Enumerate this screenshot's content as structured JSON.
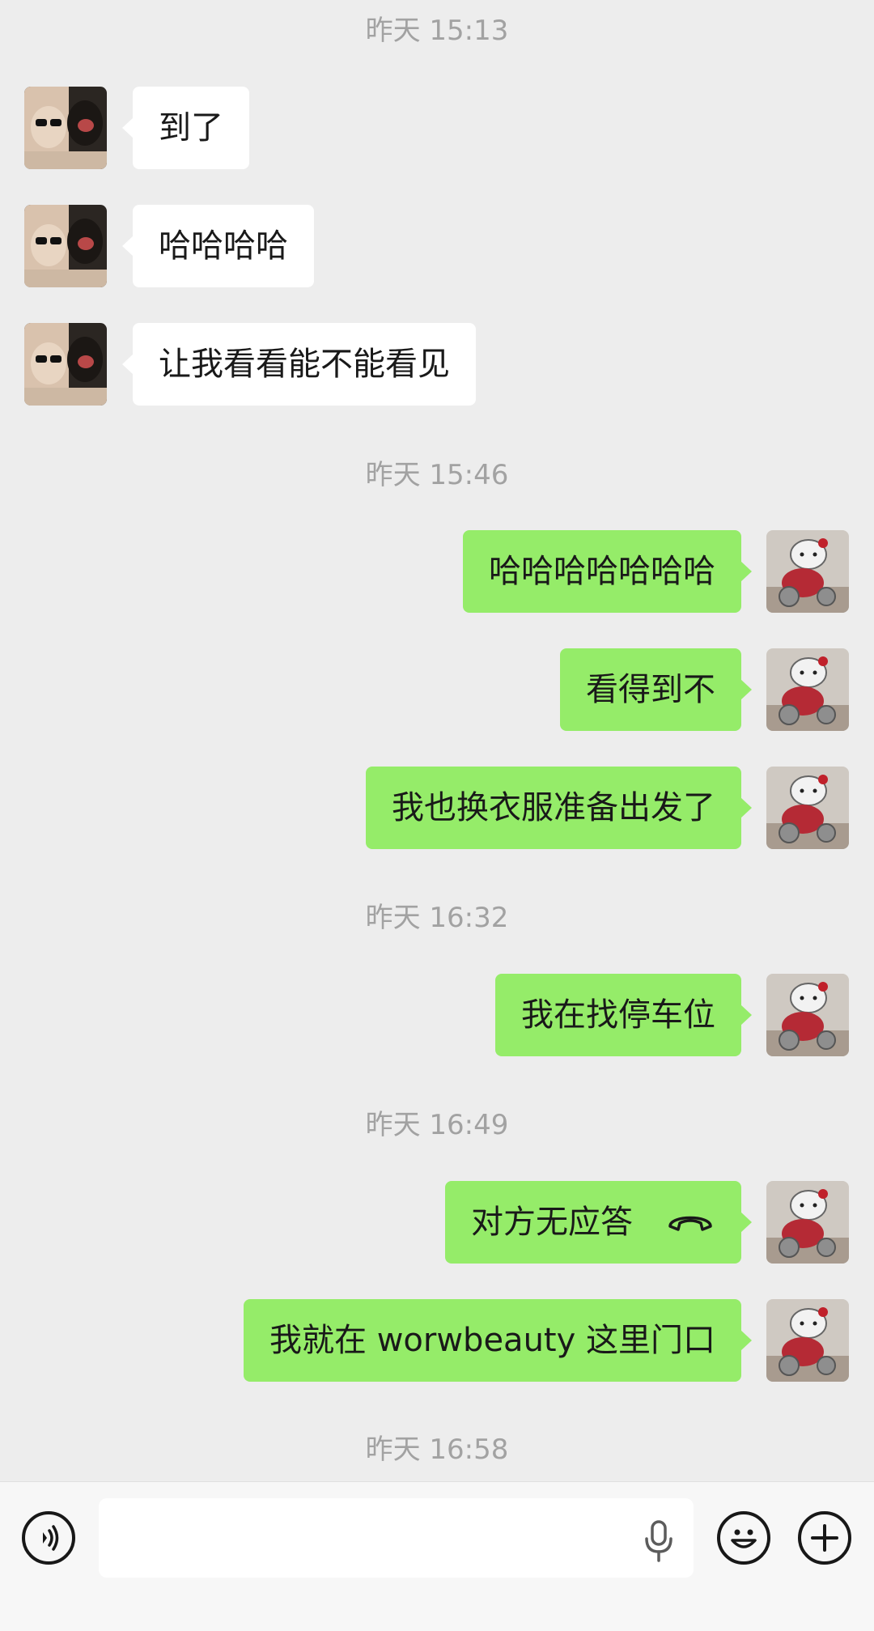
{
  "messages": [
    {
      "time": "昨天 15:13"
    },
    {
      "from": "them",
      "text": "到了"
    },
    {
      "from": "them",
      "text": "哈哈哈哈"
    },
    {
      "from": "them",
      "text": "让我看看能不能看见"
    },
    {
      "time": "昨天 15:46"
    },
    {
      "from": "me",
      "text": "哈哈哈哈哈哈哈"
    },
    {
      "from": "me",
      "text": "看得到不"
    },
    {
      "from": "me",
      "text": "我也换衣服准备出发了"
    },
    {
      "time": "昨天 16:32"
    },
    {
      "from": "me",
      "text": "我在找停车位"
    },
    {
      "time": "昨天 16:49"
    },
    {
      "from": "me",
      "text": "对方无应答",
      "icon": "phone-hangup-icon"
    },
    {
      "from": "me",
      "text": "我就在 worwbeauty 这里门口"
    },
    {
      "time": "昨天 16:58"
    }
  ],
  "input_bar": {
    "text_value": "",
    "left_icon": "voice-icon",
    "mic_icon": "microphone-icon",
    "emoji_icon": "emoji-icon",
    "plus_icon": "plus-icon"
  },
  "colors": {
    "background": "#ededed",
    "incoming_bubble": "#ffffff",
    "outgoing_bubble": "#95ec69",
    "timestamp": "#a2a2a2"
  }
}
